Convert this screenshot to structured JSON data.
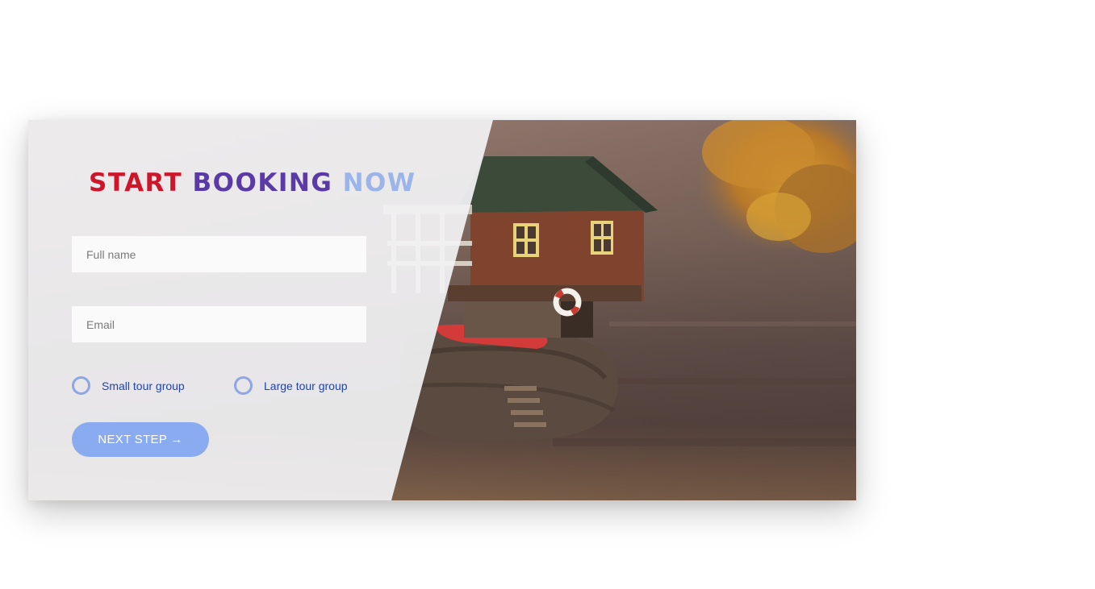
{
  "booking": {
    "title_part1": "START",
    "title_part2": "BOOKING",
    "title_part3": "NOW",
    "name_placeholder": "Full name",
    "email_placeholder": "Email",
    "options": [
      {
        "label": "Small tour group",
        "selected": false
      },
      {
        "label": "Large tour group",
        "selected": false
      }
    ],
    "next_button": "NEXT STEP →"
  },
  "colors": {
    "title_red": "#d0152b",
    "title_purple": "#5a3aa8",
    "title_light_blue": "#9bb4ea",
    "accent_blue": "#1e44b5",
    "button_blue": "#8aabf0",
    "radio_border": "#8da6e4"
  }
}
